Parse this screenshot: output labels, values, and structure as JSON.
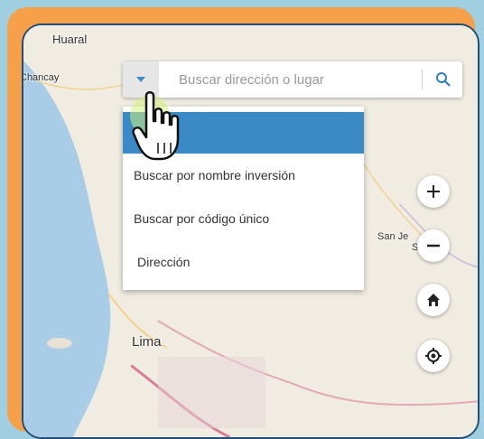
{
  "map": {
    "places": {
      "huaral": "Huaral",
      "chancay": "Chancay",
      "lima": "Lima",
      "san_jeronimo": "San Je     de",
      "san_jeronimo_2": "S"
    }
  },
  "search": {
    "placeholder": "Buscar dirección o lugar"
  },
  "menu": {
    "items": [
      {
        "label": ""
      },
      {
        "label": "Buscar por nombre inversión"
      },
      {
        "label": "Buscar por código único"
      },
      {
        "label": "Dirección"
      }
    ]
  },
  "colors": {
    "frame_orange": "#f7a04a",
    "border_blue": "#1f4e79",
    "accent_blue": "#3a8ac6"
  },
  "icons": [
    "caret-down-icon",
    "search-icon",
    "zoom-in-icon",
    "zoom-out-icon",
    "home-icon",
    "locate-icon",
    "hand-pointer-icon"
  ]
}
